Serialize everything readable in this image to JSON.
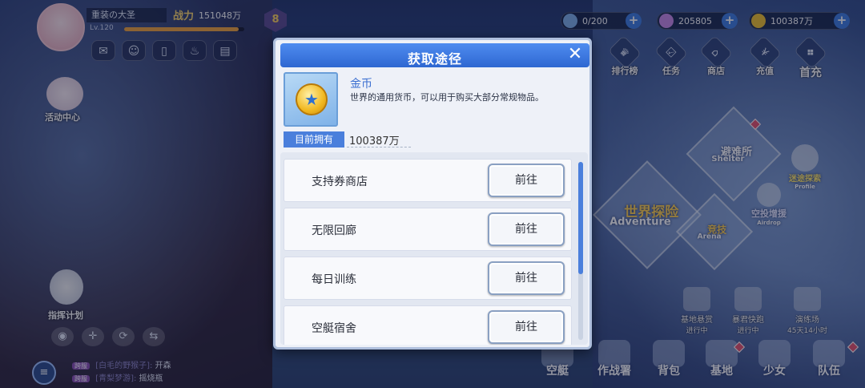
{
  "player": {
    "name": "重装の大圣",
    "power_label": "战力",
    "power_value": "151048万",
    "level": "Lv.120",
    "vip": "8"
  },
  "resources": [
    {
      "icon": "energy-crystal-icon",
      "value": "0/200",
      "color": "#7fb0e8"
    },
    {
      "icon": "diamond-icon",
      "value": "205805",
      "color": "#c889e6"
    },
    {
      "icon": "gold-coin-icon",
      "value": "100387万",
      "color": "#f1c12a"
    }
  ],
  "top_nav": [
    "排行榜",
    "任务",
    "商店",
    "充值",
    "首充"
  ],
  "left_side": {
    "activity": "活动中心",
    "command": "指挥计划"
  },
  "chat": [
    {
      "tag": "跨服",
      "name": "[白毛的野猴子]:",
      "text": "开森"
    },
    {
      "tag": "跨服",
      "name": "[青梨梦游]:",
      "text": "摇烧瓶"
    }
  ],
  "right_side": {
    "shelter": {
      "title": "避难所",
      "sub": "Shelter"
    },
    "adventure": {
      "title": "世界探险",
      "sub": "Adventure"
    },
    "arena": {
      "title": "竞技",
      "sub": "Arena"
    },
    "explore": {
      "title": "迷途探索",
      "sub": "Profile"
    },
    "airdrop": {
      "title": "空投增援",
      "sub": "Airdrop"
    }
  },
  "events": [
    {
      "name": "基地悬赏",
      "status": "进行中"
    },
    {
      "name": "暴君快跑",
      "status": "进行中"
    },
    {
      "name": "演练场",
      "status": "45天14小时"
    }
  ],
  "bottom_nav": [
    "空艇",
    "作战署",
    "背包",
    "基地",
    "少女",
    "队伍"
  ],
  "modal": {
    "title": "获取途径",
    "close": "✕",
    "item_name": "金币",
    "item_desc": "世界的通用货币，可以用于购买大部分常规物品。",
    "own_label": "目前拥有",
    "own_value": "100387万",
    "sources": [
      {
        "name": "支持券商店",
        "button": "前往"
      },
      {
        "name": "无限回廊",
        "button": "前往"
      },
      {
        "name": "每日训练",
        "button": "前往"
      },
      {
        "name": "空艇宿舍",
        "button": "前往"
      }
    ]
  },
  "colors": {
    "header": "#2e67d1",
    "accent": "#4a7fdc",
    "item_name": "#3b6fd1"
  }
}
